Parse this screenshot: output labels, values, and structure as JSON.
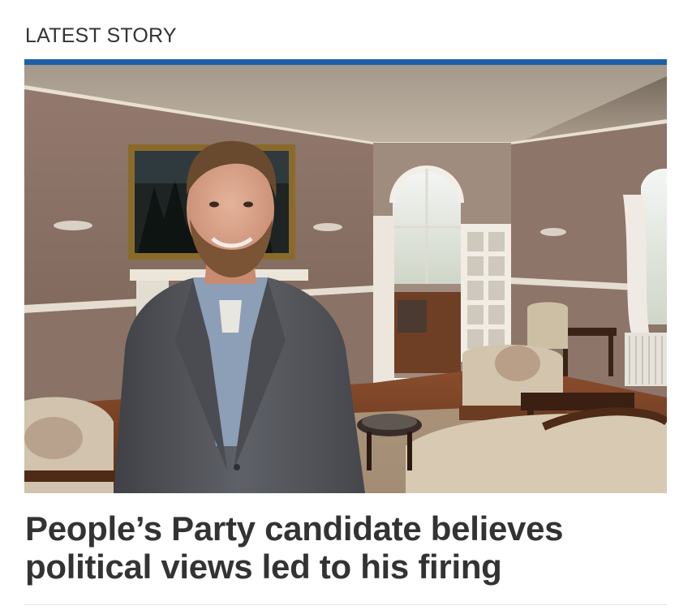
{
  "section": {
    "label": "LATEST STORY"
  },
  "story": {
    "headline": "People’s Party candidate believes political views led to his firing",
    "image": {
      "subject": "smiling-man-in-grey-suit-in-heritage-room"
    }
  },
  "colors": {
    "accent": "#1d5fa8",
    "text": "#333333",
    "wall": "#8a7468",
    "ceiling": "#b8a99a",
    "floor": "#7a4428",
    "suit": "#55575c",
    "shirt": "#8d9fb6"
  }
}
